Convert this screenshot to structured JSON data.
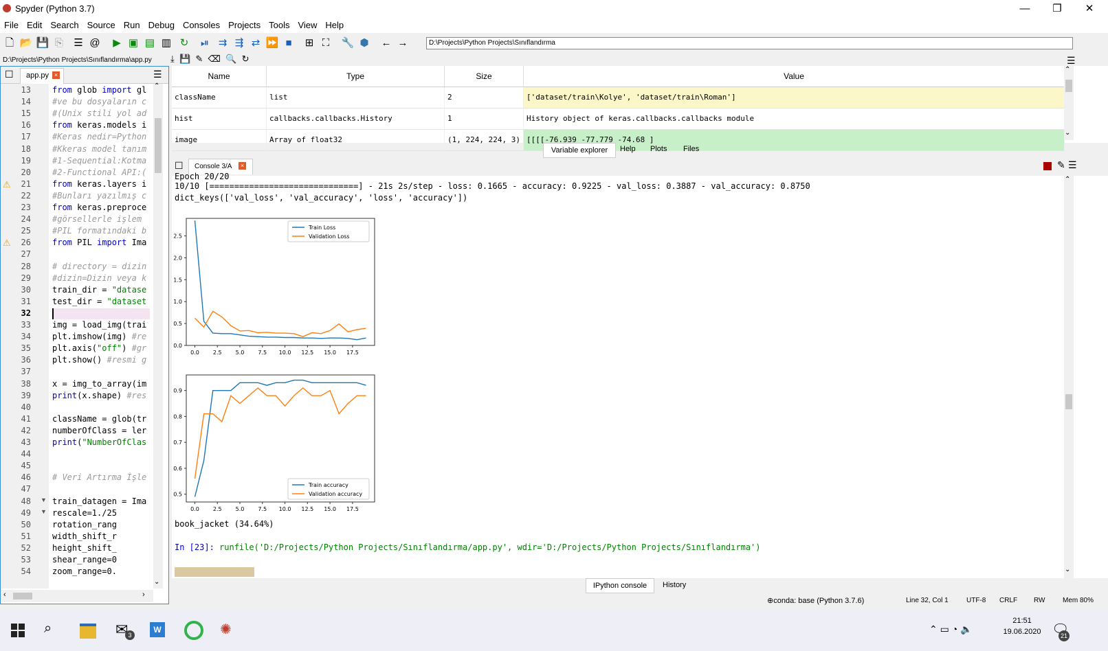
{
  "window": {
    "title": "Spyder (Python 3.7)",
    "minimize": "—",
    "restore": "❐",
    "close": "✕"
  },
  "menu": [
    "File",
    "Edit",
    "Search",
    "Source",
    "Run",
    "Debug",
    "Consoles",
    "Projects",
    "Tools",
    "View",
    "Help"
  ],
  "toolbar": {
    "path": "D:\\Projects\\Python Projects\\Sınıflandırma"
  },
  "editor": {
    "filepath": "D:\\Projects\\Python Projects\\Sınıflandırma\\app.py",
    "tab": "app.py",
    "lines": [
      {
        "n": "13",
        "t": "from glob import gl",
        "c": "code"
      },
      {
        "n": "14",
        "t": "#ve bu dosyaların c",
        "c": "cm"
      },
      {
        "n": "15",
        "t": "#(Unix stili yol ad",
        "c": "cm"
      },
      {
        "n": "16",
        "t": "from keras.models i",
        "c": "code"
      },
      {
        "n": "17",
        "t": "#Keras nedir=Python",
        "c": "cm"
      },
      {
        "n": "18",
        "t": "#Kkeras model tanım",
        "c": "cm"
      },
      {
        "n": "19",
        "t": "#1-Sequential:Kotma",
        "c": "cm"
      },
      {
        "n": "20",
        "t": "#2-Functional API:(",
        "c": "cm"
      },
      {
        "n": "21",
        "t": "from keras.layers i",
        "c": "code"
      },
      {
        "n": "22",
        "t": "#Bunları yazılmış c",
        "c": "cm"
      },
      {
        "n": "23",
        "t": "from keras.preproce",
        "c": "code"
      },
      {
        "n": "24",
        "t": "#görsellerle işlem ",
        "c": "cm"
      },
      {
        "n": "25",
        "t": "#PIL formatındaki b",
        "c": "cm"
      },
      {
        "n": "26",
        "t": "from PIL import Ima",
        "c": "code"
      },
      {
        "n": "27",
        "t": "",
        "c": "code"
      },
      {
        "n": "28",
        "t": "# directory = dizin",
        "c": "cm"
      },
      {
        "n": "29",
        "t": "#dizin=Dizin veya k",
        "c": "cm"
      },
      {
        "n": "30",
        "t": "train_dir = \"datase",
        "c": "code"
      },
      {
        "n": "31",
        "t": "test_dir = \"dataset",
        "c": "code"
      },
      {
        "n": "32",
        "t": "",
        "c": "cur"
      },
      {
        "n": "33",
        "t": "img = load_img(trai",
        "c": "code"
      },
      {
        "n": "34",
        "t": "plt.imshow(img) #re",
        "c": "code"
      },
      {
        "n": "35",
        "t": "plt.axis(\"off\") #gr",
        "c": "code"
      },
      {
        "n": "36",
        "t": "plt.show() #resmi g",
        "c": "code"
      },
      {
        "n": "37",
        "t": "",
        "c": "code"
      },
      {
        "n": "38",
        "t": "x = img_to_array(im",
        "c": "code"
      },
      {
        "n": "39",
        "t": "print(x.shape) #res",
        "c": "code"
      },
      {
        "n": "40",
        "t": "",
        "c": "code"
      },
      {
        "n": "41",
        "t": "className = glob(tr",
        "c": "code"
      },
      {
        "n": "42",
        "t": "numberOfClass = ler",
        "c": "code"
      },
      {
        "n": "43",
        "t": "print(\"NumberOfClas",
        "c": "code"
      },
      {
        "n": "44",
        "t": "",
        "c": "code"
      },
      {
        "n": "45",
        "t": "",
        "c": "code"
      },
      {
        "n": "46",
        "t": "# Veri Artırma İşle",
        "c": "cm"
      },
      {
        "n": "47",
        "t": "",
        "c": "code"
      },
      {
        "n": "48",
        "t": "train_datagen = Ima",
        "c": "code"
      },
      {
        "n": "49",
        "t": "      rescale=1./25",
        "c": "code"
      },
      {
        "n": "50",
        "t": "      rotation_rang",
        "c": "code"
      },
      {
        "n": "51",
        "t": "      width_shift_r",
        "c": "code"
      },
      {
        "n": "52",
        "t": "      height_shift_",
        "c": "code"
      },
      {
        "n": "53",
        "t": "      shear_range=0",
        "c": "code"
      },
      {
        "n": "54",
        "t": "      zoom_range=0.",
        "c": "code"
      }
    ]
  },
  "variables": {
    "headers": [
      "Name",
      "Type",
      "Size",
      "Value"
    ],
    "rows": [
      {
        "name": "className",
        "type": "list",
        "size": "2",
        "value": "['dataset/train\\Kolye', 'dataset/train\\Roman']",
        "color": "#fbf7c9"
      },
      {
        "name": "hist",
        "type": "callbacks.callbacks.History",
        "size": "1",
        "value": "History object of keras.callbacks.callbacks module",
        "color": "#ffffff"
      },
      {
        "name": "image",
        "type": "Array of float32",
        "size": "(1, 224, 224, 3)",
        "value": "[[[[-76.939     -77.779     -74.68      ]",
        "color": "#c8f0c8"
      }
    ],
    "tabs": [
      "Variable explorer",
      "Help",
      "Plots",
      "Files"
    ]
  },
  "console": {
    "tab": "Console 3/A",
    "epoch_line": "Epoch 20/20",
    "progress_line": "10/10 [==============================] - 21s 2s/step - loss: 0.1665 - accuracy: 0.9225 - val_loss: 0.3887 - val_accuracy: 0.8750",
    "keys_line": "dict_keys(['val_loss', 'val_accuracy', 'loss', 'accuracy'])",
    "prediction": "book_jacket (34.64%)",
    "prompt": "In [23]:",
    "command": " runfile('D:/Projects/Python Projects/Sınıflandırma/app.py', wdir='D:/Projects/Python Projects/Sınıflandırma')",
    "bottom_tabs": [
      "IPython console",
      "History"
    ]
  },
  "chart_data": [
    {
      "type": "line",
      "x": [
        0,
        1,
        2,
        3,
        4,
        5,
        6,
        7,
        8,
        9,
        10,
        11,
        12,
        13,
        14,
        15,
        16,
        17,
        18,
        19
      ],
      "series": [
        {
          "name": "Train Loss",
          "color": "#1f77b4",
          "values": [
            2.85,
            0.55,
            0.28,
            0.27,
            0.27,
            0.24,
            0.21,
            0.2,
            0.19,
            0.19,
            0.18,
            0.18,
            0.17,
            0.17,
            0.16,
            0.17,
            0.17,
            0.16,
            0.13,
            0.17
          ]
        },
        {
          "name": "Validation Loss",
          "color": "#ff7f0e",
          "values": [
            0.62,
            0.42,
            0.78,
            0.65,
            0.45,
            0.33,
            0.34,
            0.29,
            0.3,
            0.28,
            0.28,
            0.27,
            0.2,
            0.29,
            0.27,
            0.34,
            0.49,
            0.31,
            0.36,
            0.39
          ]
        }
      ],
      "xticks": [
        "0.0",
        "2.5",
        "5.0",
        "7.5",
        "10.0",
        "12.5",
        "15.0",
        "17.5"
      ],
      "yticks": [
        "0.0",
        "0.5",
        "1.0",
        "1.5",
        "2.0",
        "2.5"
      ],
      "ylim": [
        0,
        2.9
      ],
      "legend": "top-right"
    },
    {
      "type": "line",
      "x": [
        0,
        1,
        2,
        3,
        4,
        5,
        6,
        7,
        8,
        9,
        10,
        11,
        12,
        13,
        14,
        15,
        16,
        17,
        18,
        19
      ],
      "series": [
        {
          "name": "Train accuracy",
          "color": "#1f77b4",
          "values": [
            0.49,
            0.63,
            0.9,
            0.9,
            0.9,
            0.93,
            0.93,
            0.93,
            0.92,
            0.93,
            0.93,
            0.94,
            0.94,
            0.93,
            0.93,
            0.93,
            0.93,
            0.93,
            0.93,
            0.92
          ]
        },
        {
          "name": "Validation accuracy",
          "color": "#ff7f0e",
          "values": [
            0.56,
            0.81,
            0.81,
            0.78,
            0.88,
            0.85,
            0.88,
            0.91,
            0.88,
            0.88,
            0.84,
            0.88,
            0.91,
            0.88,
            0.88,
            0.9,
            0.81,
            0.85,
            0.88,
            0.88
          ]
        }
      ],
      "xticks": [
        "0.0",
        "2.5",
        "5.0",
        "7.5",
        "10.0",
        "12.5",
        "15.0",
        "17.5"
      ],
      "yticks": [
        "0.5",
        "0.6",
        "0.7",
        "0.8",
        "0.9"
      ],
      "ylim": [
        0.47,
        0.96
      ],
      "legend": "bottom-right"
    }
  ],
  "status": {
    "conda": "conda: base (Python 3.7.6)",
    "position": "Line 32, Col 1",
    "encoding": "UTF-8",
    "eol": "CRLF",
    "perm": "RW",
    "mem": "Mem 80%"
  },
  "taskbar": {
    "time": "21:51",
    "date": "19.06.2020",
    "mail_badge": "3",
    "notif_badge": "21"
  }
}
